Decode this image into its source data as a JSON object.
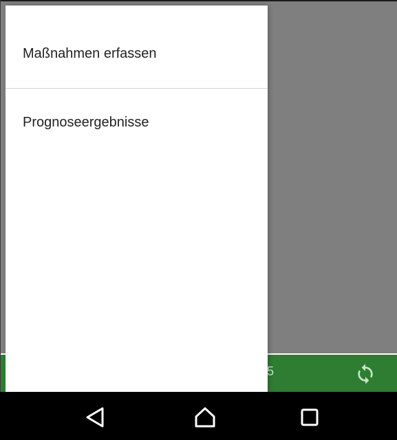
{
  "drawer": {
    "items": [
      {
        "label": "Maßnahmen erfassen"
      },
      {
        "label": "Prognoseergebnisse"
      }
    ]
  },
  "app_bottom_bar": {
    "partial_text": "5",
    "icon": "sync-icon",
    "color": "#2e7d32"
  },
  "system_nav": {
    "buttons": [
      {
        "icon": "back-icon"
      },
      {
        "icon": "home-icon"
      },
      {
        "icon": "recents-icon"
      }
    ]
  },
  "colors": {
    "scrim": "rgba(0,0,0,0.5)",
    "drawer_background": "#ffffff",
    "nav_bar": "#000000",
    "text_primary": "#212121"
  }
}
